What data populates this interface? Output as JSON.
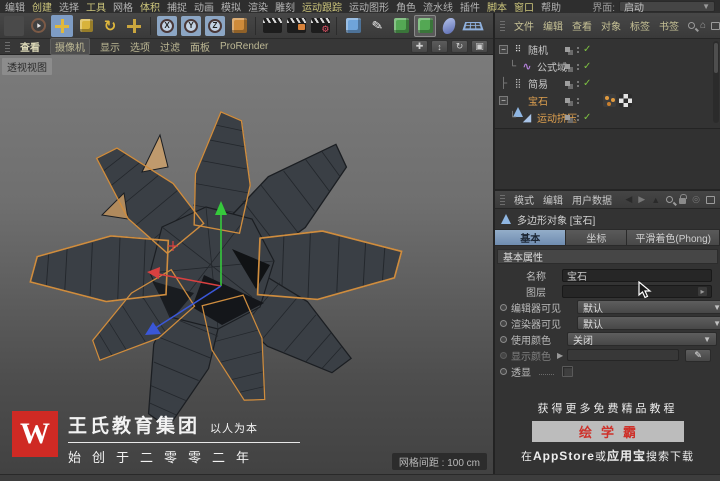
{
  "menu_bar": {
    "items": [
      {
        "label": "编辑",
        "accent": false
      },
      {
        "label": "创建",
        "accent": true
      },
      {
        "label": "选择",
        "accent": false
      },
      {
        "label": "工具",
        "accent": true
      },
      {
        "label": "网格",
        "accent": false
      },
      {
        "label": "体积",
        "accent": true
      },
      {
        "label": "捕捉",
        "accent": false
      },
      {
        "label": "动画",
        "accent": false
      },
      {
        "label": "模拟",
        "accent": false
      },
      {
        "label": "渲染",
        "accent": false
      },
      {
        "label": "雕刻",
        "accent": false
      },
      {
        "label": "运动跟踪",
        "accent": true
      },
      {
        "label": "运动图形",
        "accent": false
      },
      {
        "label": "角色",
        "accent": false
      },
      {
        "label": "流水线",
        "accent": false
      },
      {
        "label": "插件",
        "accent": false
      },
      {
        "label": "脚本",
        "accent": true
      },
      {
        "label": "窗口",
        "accent": true
      },
      {
        "label": "帮助",
        "accent": false
      }
    ],
    "interface_label": "界面:",
    "interface_value": "启动"
  },
  "toolbar": {
    "icons": [
      "undo",
      "live-selection",
      "move-tool",
      "scale-tool",
      "rotate-tool",
      "last-used-tool",
      "axis-lock-x",
      "axis-lock-y",
      "axis-lock-z",
      "coordinate-system",
      "render-view",
      "render-to-picture-viewer",
      "edit-render-settings",
      "add-primitive",
      "pen-spline",
      "subdivision-surface",
      "deformer",
      "bend-deformer",
      "floor-object"
    ],
    "axis_x": "X",
    "axis_y": "Y",
    "axis_z": "Z"
  },
  "viewport": {
    "menu": [
      "查看",
      "摄像机",
      "显示",
      "选项",
      "过滤",
      "面板",
      "ProRender"
    ],
    "controls": [
      "pan",
      "zoom",
      "rotate",
      "toggle-views"
    ],
    "view_label": "透视视图",
    "grid_status": "网格间距 : 100 cm"
  },
  "object_manager": {
    "menu": [
      "文件",
      "编辑",
      "查看",
      "对象",
      "标签",
      "书签"
    ],
    "rows": [
      {
        "label": "随机",
        "icon": "random-effector",
        "depth": 0,
        "selected": false
      },
      {
        "label": "公式域",
        "icon": "formula-field",
        "depth": 1,
        "selected": false
      },
      {
        "label": "简易",
        "icon": "plain-effector",
        "depth": 1,
        "selected": false
      },
      {
        "label": "宝石",
        "icon": "polygon-object",
        "depth": 0,
        "selected": true,
        "tags": [
          "phong-tag",
          "uvw-tag"
        ]
      },
      {
        "label": "运动挤压",
        "icon": "moextrude",
        "depth": 1,
        "selected": true
      }
    ]
  },
  "attributes": {
    "menu": [
      "模式",
      "编辑",
      "用户数据"
    ],
    "title": "多边形对象 [宝石]",
    "tabs": [
      {
        "label": "基本",
        "active": true
      },
      {
        "label": "坐标",
        "active": false
      },
      {
        "label": "平滑着色(Phong)",
        "active": false
      }
    ],
    "section": "基本属性",
    "rows": {
      "name": {
        "label": "名称",
        "value": "宝石"
      },
      "layer": {
        "label": "图层",
        "value": ""
      },
      "editor_visible": {
        "label": "编辑器可见",
        "value": "默认"
      },
      "renderer_visible": {
        "label": "渲染器可见",
        "value": "默认"
      },
      "use_color": {
        "label": "使用颜色",
        "value": "关闭"
      },
      "display_color": {
        "label": "显示颜色"
      },
      "xray": {
        "label": "透显",
        "checked": false
      }
    }
  },
  "watermark": {
    "logo": "W",
    "company": "王氏教育集团",
    "slogan": "以人为本",
    "tagline": "始创于二零零二年"
  },
  "ad": {
    "line1": "获得更多免费精品教程",
    "brand": "绘学霸",
    "line3_prefix": "在",
    "line3_bold1": "AppStore",
    "line3_mid": "或",
    "line3_bold2": "应用宝",
    "line3_suffix": "搜索下载"
  },
  "colors": {
    "selected_text": "#e0a14f",
    "active_tab": "#7f9cbd",
    "axis_x": "#d84040",
    "axis_y": "#36c93c",
    "axis_z": "#3a57d8",
    "selection_outline": "#cf8d3f",
    "watermark_red": "#cf2a24"
  }
}
